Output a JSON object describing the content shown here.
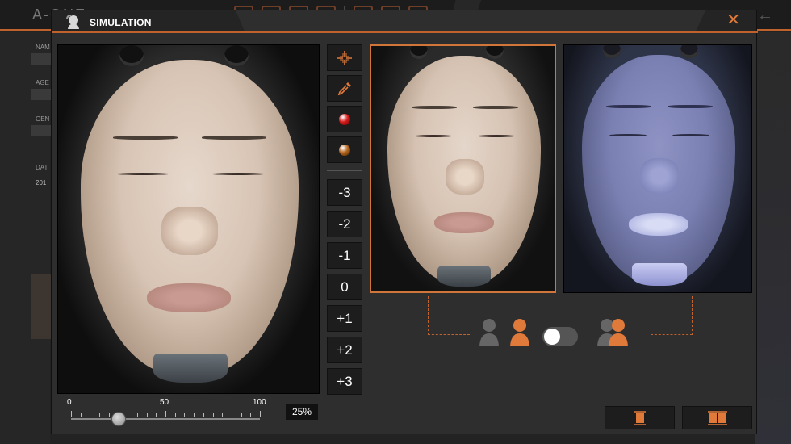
{
  "background": {
    "logo": "A-ONE",
    "labels": [
      "NAM",
      "AGE",
      "GEN",
      "DAT"
    ],
    "date_fragment": "201"
  },
  "modal": {
    "title": "SIMULATION",
    "close_symbol": "✕"
  },
  "slider": {
    "labels": [
      "0",
      "50",
      "100"
    ],
    "value_percent": 25,
    "display": "25%"
  },
  "toolbar": {
    "tools": [
      {
        "icon": "crosshair-icon"
      },
      {
        "icon": "eyedropper-icon"
      },
      {
        "icon": "red-ball-icon",
        "color": "#d71a1a"
      },
      {
        "icon": "brown-ball-icon",
        "color": "#b5651d"
      }
    ],
    "levels": [
      "-3",
      "-2",
      "-1",
      "0",
      "+1",
      "+2",
      "+3"
    ]
  },
  "colors": {
    "accent": "#c0622b",
    "accent_bright": "#e07a3a",
    "panel": "#2e2e2e"
  }
}
